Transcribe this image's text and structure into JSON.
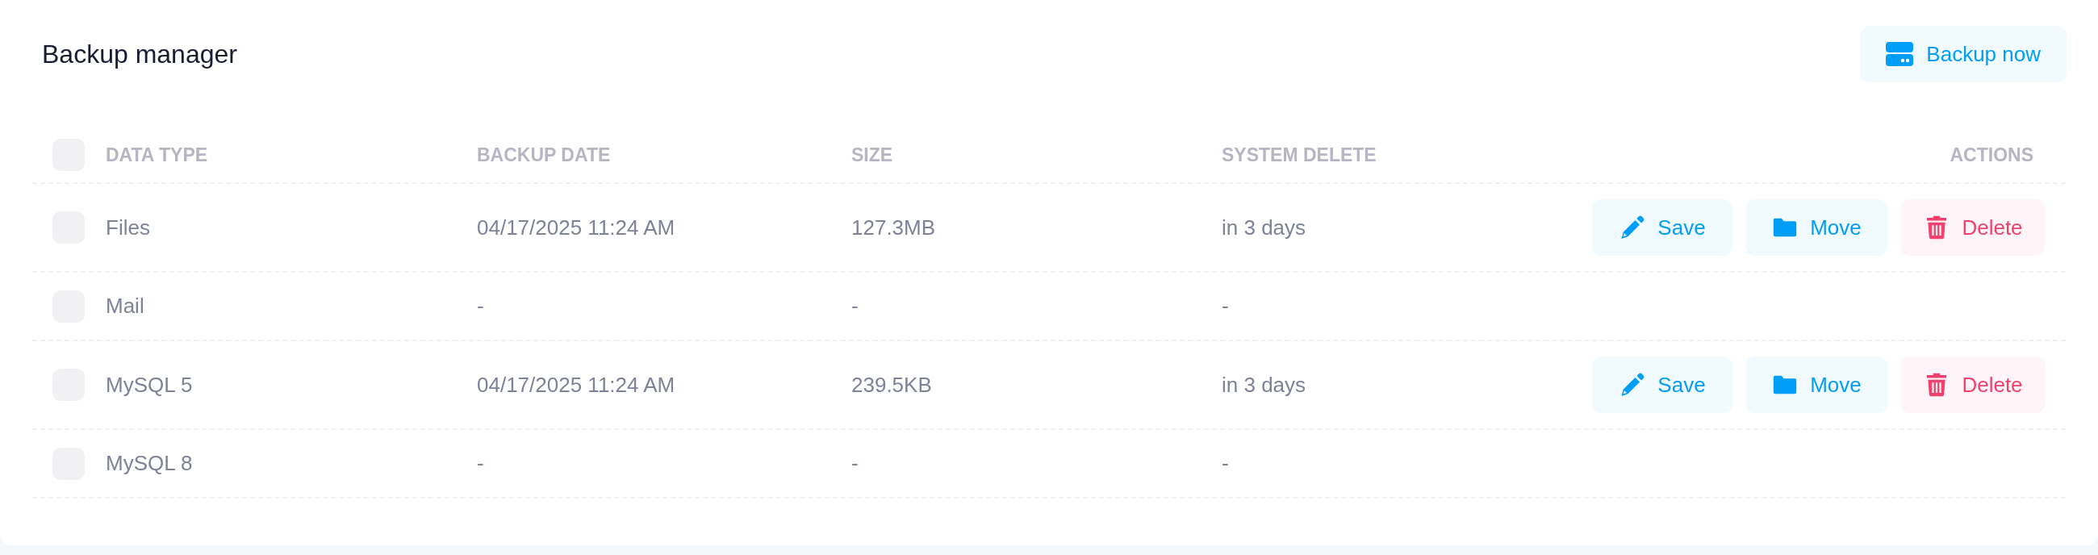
{
  "title": "Backup manager",
  "backup_button": {
    "label": "Backup now"
  },
  "table": {
    "select_all": {
      "checked": false
    },
    "columns": [
      "DATA TYPE",
      "BACKUP DATE",
      "SIZE",
      "SYSTEM DELETE",
      "ACTIONS"
    ],
    "rows": [
      {
        "checked": false,
        "data_type": "Files",
        "backup_date": "04/17/2025 11:24 AM",
        "size": "127.3MB",
        "system_delete": "in 3 days",
        "actions": [
          {
            "kind": "save",
            "label": "Save"
          },
          {
            "kind": "move",
            "label": "Move"
          },
          {
            "kind": "delete",
            "label": "Delete"
          }
        ]
      },
      {
        "checked": false,
        "data_type": "Mail",
        "backup_date": "-",
        "size": "-",
        "system_delete": "-"
      },
      {
        "checked": false,
        "data_type": "MySQL 5",
        "backup_date": "04/17/2025 11:24 AM",
        "size": "239.5KB",
        "system_delete": "in 3 days",
        "actions": [
          {
            "kind": "save",
            "label": "Save"
          },
          {
            "kind": "move",
            "label": "Move"
          },
          {
            "kind": "delete",
            "label": "Delete"
          }
        ]
      },
      {
        "checked": false,
        "data_type": "MySQL 8",
        "backup_date": "-",
        "size": "-",
        "system_delete": "-"
      }
    ]
  }
}
